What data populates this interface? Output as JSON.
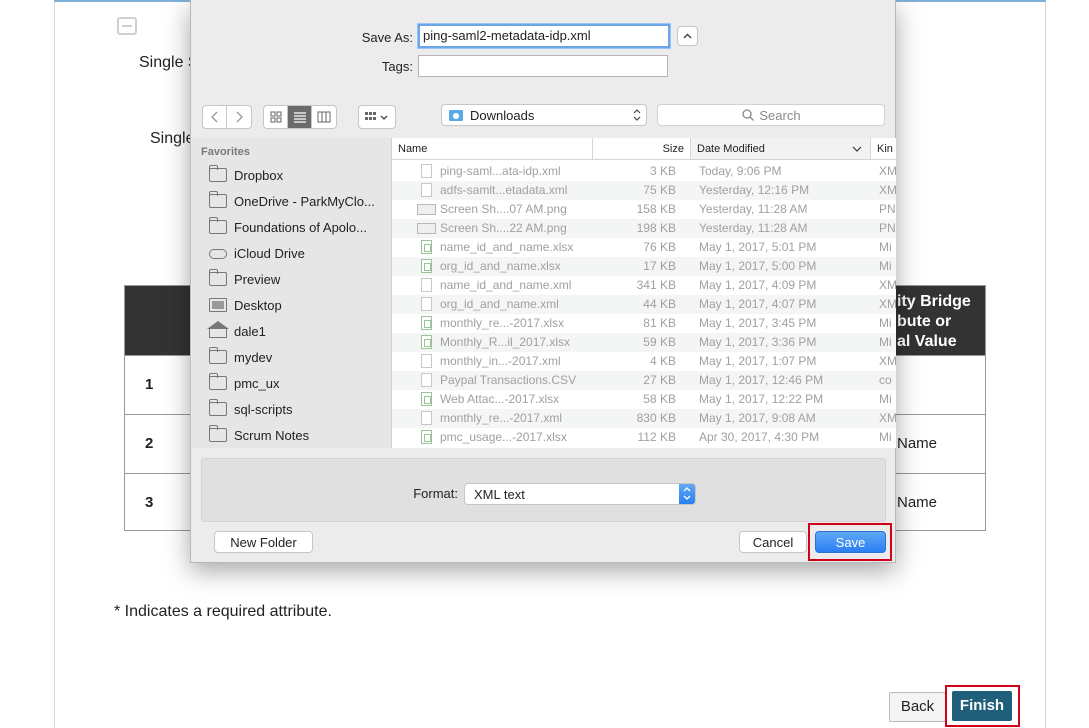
{
  "background": {
    "single_sign_on_1": "Single S",
    "single_sign_on_2": "Single",
    "table_header": "ity Bridge\nbute or\nal Value",
    "rows": [
      {
        "num": "1",
        "value": ""
      },
      {
        "num": "2",
        "value": "Name"
      },
      {
        "num": "3",
        "value": "Name"
      }
    ],
    "required_note": "* Indicates a required attribute.",
    "back_label": "Back",
    "finish_label": "Finish"
  },
  "dialog": {
    "save_as_label": "Save As:",
    "save_as_value": "ping-saml2-metadata-idp.xml",
    "tags_label": "Tags:",
    "tags_value": "",
    "location": "Downloads",
    "search_placeholder": "Search",
    "sidebar": {
      "heading": "Favorites",
      "items": [
        {
          "label": "Dropbox",
          "icon": "folder-icon"
        },
        {
          "label": "OneDrive - ParkMyClo...",
          "icon": "folder-icon"
        },
        {
          "label": "Foundations of Apolo...",
          "icon": "folder-icon"
        },
        {
          "label": "iCloud Drive",
          "icon": "cloud-icon"
        },
        {
          "label": "Preview",
          "icon": "folder-icon"
        },
        {
          "label": "Desktop",
          "icon": "desktop-icon"
        },
        {
          "label": "dale1",
          "icon": "home-icon"
        },
        {
          "label": "mydev",
          "icon": "folder-icon"
        },
        {
          "label": "pmc_ux",
          "icon": "folder-icon"
        },
        {
          "label": "sql-scripts",
          "icon": "folder-icon"
        },
        {
          "label": "Scrum Notes",
          "icon": "folder-icon"
        }
      ]
    },
    "columns": {
      "name": "Name",
      "size": "Size",
      "date": "Date Modified",
      "kind": "Kin"
    },
    "files": [
      {
        "name": "ping-saml...ata-idp.xml",
        "size": "3 KB",
        "date": "Today, 9:06 PM",
        "kind": "XM",
        "icon": "doc"
      },
      {
        "name": "adfs-samlt...etadata.xml",
        "size": "75 KB",
        "date": "Yesterday, 12:16 PM",
        "kind": "XM",
        "icon": "doc"
      },
      {
        "name": "Screen Sh....07 AM.png",
        "size": "158 KB",
        "date": "Yesterday, 11:28 AM",
        "kind": "PN",
        "icon": "img"
      },
      {
        "name": "Screen Sh....22 AM.png",
        "size": "198 KB",
        "date": "Yesterday, 11:28 AM",
        "kind": "PN",
        "icon": "img"
      },
      {
        "name": "name_id_and_name.xlsx",
        "size": "76 KB",
        "date": "May 1, 2017, 5:01 PM",
        "kind": "Mi",
        "icon": "sheet"
      },
      {
        "name": "org_id_and_name.xlsx",
        "size": "17 KB",
        "date": "May 1, 2017, 5:00 PM",
        "kind": "Mi",
        "icon": "sheet"
      },
      {
        "name": "name_id_and_name.xml",
        "size": "341 KB",
        "date": "May 1, 2017, 4:09 PM",
        "kind": "XM",
        "icon": "doc"
      },
      {
        "name": "org_id_and_name.xml",
        "size": "44 KB",
        "date": "May 1, 2017, 4:07 PM",
        "kind": "XM",
        "icon": "doc"
      },
      {
        "name": "monthly_re...-2017.xlsx",
        "size": "81 KB",
        "date": "May 1, 2017, 3:45 PM",
        "kind": "Mi",
        "icon": "sheet"
      },
      {
        "name": "Monthly_R...il_2017.xlsx",
        "size": "59 KB",
        "date": "May 1, 2017, 3:36 PM",
        "kind": "Mi",
        "icon": "sheet"
      },
      {
        "name": "monthly_in...-2017.xml",
        "size": "4 KB",
        "date": "May 1, 2017, 1:07 PM",
        "kind": "XM",
        "icon": "doc"
      },
      {
        "name": "Paypal Transactions.CSV",
        "size": "27 KB",
        "date": "May 1, 2017, 12:46 PM",
        "kind": "co",
        "icon": "doc"
      },
      {
        "name": "Web Attac...-2017.xlsx",
        "size": "58 KB",
        "date": "May 1, 2017, 12:22 PM",
        "kind": "Mi",
        "icon": "sheet"
      },
      {
        "name": "monthly_re...-2017.xml",
        "size": "830 KB",
        "date": "May 1, 2017, 9:08 AM",
        "kind": "XM",
        "icon": "doc"
      },
      {
        "name": "pmc_usage...-2017.xlsx",
        "size": "112 KB",
        "date": "Apr 30, 2017, 4:30 PM",
        "kind": "Mi",
        "icon": "sheet"
      }
    ],
    "format_label": "Format:",
    "format_value": "XML text",
    "new_folder_label": "New Folder",
    "cancel_label": "Cancel",
    "save_label": "Save",
    "colors": {
      "accent": "#2a7ff0",
      "highlight": "#d0021b",
      "finish": "#1f5f7a"
    }
  }
}
